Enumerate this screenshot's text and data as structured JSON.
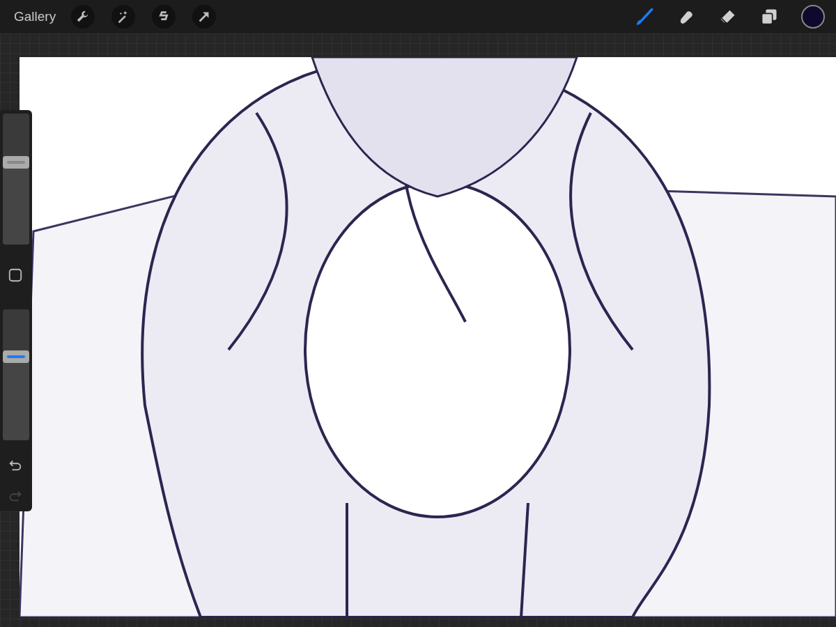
{
  "top_bar": {
    "gallery": "Gallery",
    "actions": [
      {
        "kind": "wrench"
      },
      {
        "kind": "wand"
      },
      {
        "kind": "selection"
      },
      {
        "kind": "transform"
      }
    ],
    "tools": [
      {
        "kind": "brush",
        "selected": true
      },
      {
        "kind": "smudge",
        "selected": false
      },
      {
        "kind": "eraser",
        "selected": false
      },
      {
        "kind": "layers",
        "selected": false
      }
    ],
    "color_swatch": {
      "color": "#0e0a2e"
    }
  },
  "sidebar": {
    "sliders": [
      {
        "kind": "size",
        "level": 0.63
      },
      {
        "kind": "opacity",
        "level": 0.64
      }
    ],
    "undo": {
      "disabled": false
    },
    "redo": {
      "disabled": true
    }
  }
}
